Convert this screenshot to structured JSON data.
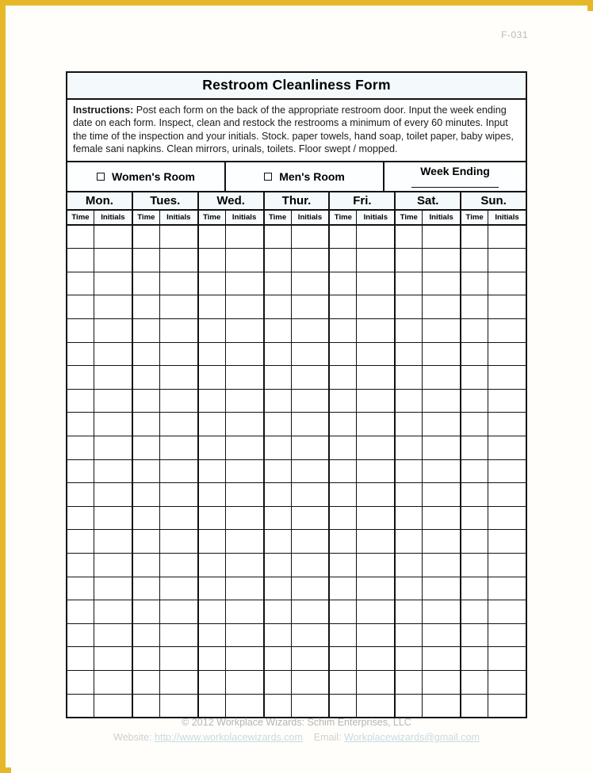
{
  "page": {
    "form_code": "F-031",
    "border_color": "#e5b82a",
    "background_color": "#fffdf8"
  },
  "form": {
    "title": "Restroom Cleanliness Form",
    "instructions_label": "Instructions:",
    "instructions_text": " Post each form on the back of the appropriate restroom door. Input the week ending date on each form. Inspect, clean and restock the restrooms a minimum of every 60 minutes. Input the time of the inspection and your initials. Stock. paper towels, hand soap, toilet paper, baby wipes, female sani napkins. Clean mirrors, urinals, toilets. Floor swept / mopped.",
    "rooms": [
      {
        "label": "Women's Room",
        "checkbox": "unchecked"
      },
      {
        "label": "Men's Room",
        "checkbox": "unchecked"
      }
    ],
    "week_ending_label": "Week Ending",
    "week_ending_value": "",
    "days": [
      "Mon.",
      "Tues.",
      "Wed.",
      "Thur.",
      "Fri.",
      "Sat.",
      "Sun."
    ],
    "sub_headers": {
      "time": "Time",
      "initials": "Initials"
    },
    "body_row_count": 21,
    "colors": {
      "header_fill": "#f4fafc",
      "grid_line": "#121212",
      "text": "#000000"
    }
  },
  "footer": {
    "copyright": "© 2012 Workplace Wizards: Schim Enterprises, LLC",
    "website_label": "Website:",
    "website_url": "http://www.workplacewizards.com",
    "email_label": "Email:",
    "email_address": "Workplacewizards@gmail.com"
  }
}
